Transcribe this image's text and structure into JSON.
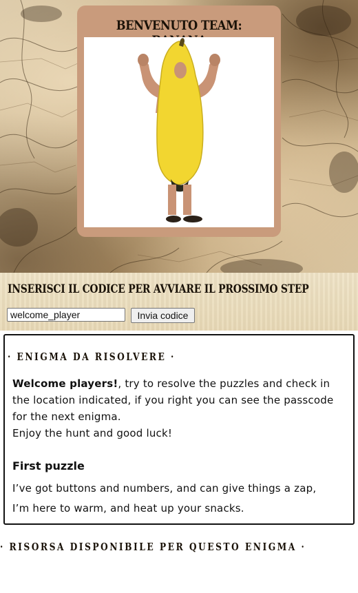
{
  "welcome_card": {
    "title": "Benvenuto team: Banana",
    "image": "banana-costume-photo"
  },
  "code_section": {
    "title": "Inserisci il codice per avviare il prossimo step",
    "input_value": "welcome_player",
    "submit_label": "Invia codice"
  },
  "enigma": {
    "title": "· Enigma da risolvere ·",
    "intro_bold": "Welcome players!",
    "intro_rest": ", try to resolve the puzzles and check in the location indicated, if you right you can see the passcode for the next enigma.",
    "intro_line2": "Enjoy the hunt and good luck!",
    "puzzle_title": "First puzzle",
    "riddle_line1": "I’ve got buttons and numbers, and can give things a zap,",
    "riddle_line2": "I’m here to warm, and heat up your snacks."
  },
  "resource": {
    "title": "· Risorsa disponibile per questo enigma ·"
  },
  "colors": {
    "card_bg": "#c99b7c",
    "strip_bg": "#efe3c6",
    "banana_yellow": "#f2d630"
  }
}
